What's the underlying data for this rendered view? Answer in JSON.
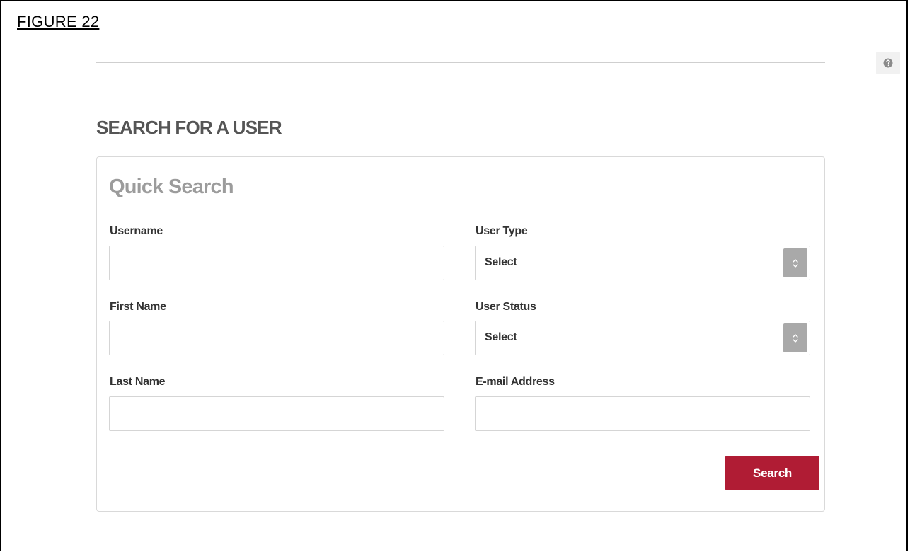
{
  "figure": {
    "label": "FIGURE 22"
  },
  "help": {
    "icon": "question-circle-icon"
  },
  "page": {
    "title": "SEARCH FOR A USER"
  },
  "quick_search": {
    "title": "Quick Search",
    "fields": {
      "username": {
        "label": "Username",
        "value": ""
      },
      "user_type": {
        "label": "User Type",
        "value": "Select"
      },
      "first_name": {
        "label": "First Name",
        "value": ""
      },
      "user_status": {
        "label": "User Status",
        "value": "Select"
      },
      "last_name": {
        "label": "Last Name",
        "value": ""
      },
      "email": {
        "label": "E-mail Address",
        "value": ""
      }
    },
    "search_label": "Search"
  },
  "colors": {
    "accent": "#b01c34",
    "panel_title": "#9c9c9c",
    "select_caret": "#a9a9a9"
  }
}
